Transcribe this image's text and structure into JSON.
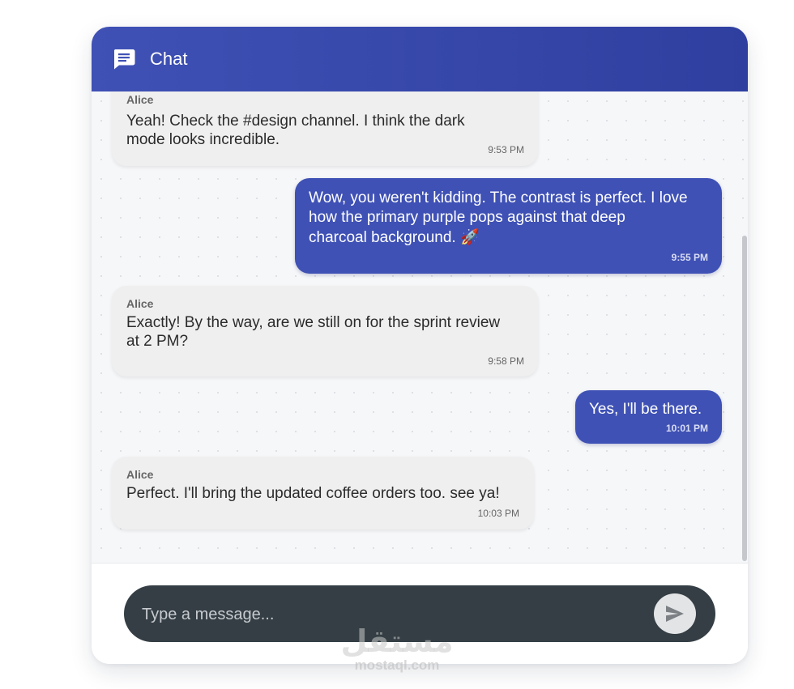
{
  "header": {
    "icon": "chat-bubble-icon",
    "title": "Chat"
  },
  "messages": [
    {
      "direction": "incoming",
      "sender": "Alice",
      "text_lines": [
        "Yeah! Check the #design channel. I think the dark",
        "mode looks incredible."
      ],
      "time": "9:53 PM"
    },
    {
      "direction": "outgoing",
      "text_lines": [
        "Wow, you weren't kidding. The contrast is perfect. I love",
        "how the primary purple pops against that deep",
        "charcoal background. 🚀"
      ],
      "time": "9:55 PM"
    },
    {
      "direction": "incoming",
      "sender": "Alice",
      "text_lines": [
        "Exactly! By the way, are we still on for the sprint review",
        "at 2 PM?"
      ],
      "time": "9:58 PM"
    },
    {
      "direction": "outgoing",
      "text_lines": [
        "Yes, I'll be there."
      ],
      "time": "10:01 PM"
    },
    {
      "direction": "incoming",
      "sender": "Alice",
      "text_lines": [
        "Perfect. I'll bring the updated coffee orders too. see ya!"
      ],
      "time": "10:03 PM"
    }
  ],
  "composer": {
    "placeholder": "Type a message...",
    "value": "",
    "send_icon": "send-icon"
  },
  "watermark": {
    "logo_text": "مستقل",
    "url": "mostaql.com"
  },
  "colors": {
    "primary": "#3f51b5",
    "header_end": "#2f3fa0",
    "incoming_bubble": "#efefef",
    "composer_bg": "#343e44"
  }
}
